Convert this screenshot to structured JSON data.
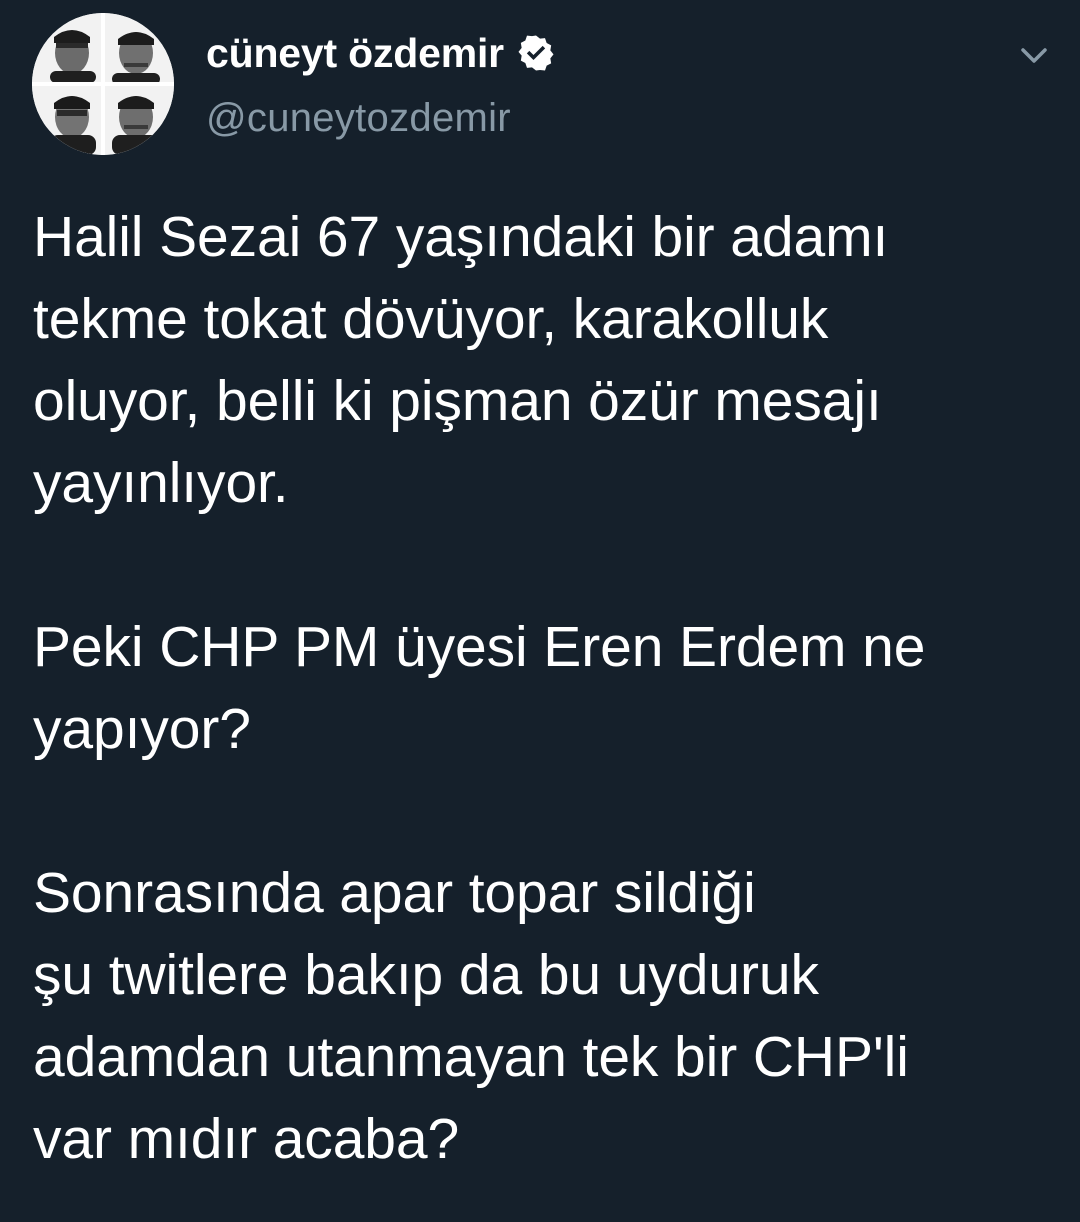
{
  "author": {
    "display_name": "cüneyt özdemir",
    "handle": "@cuneytozdemir",
    "verified": true,
    "avatar": "profile-photo-grid"
  },
  "menu": {
    "icon": "chevron-down-icon"
  },
  "tweet": {
    "paragraphs": [
      {
        "lines": [
          "Halil Sezai 67 yaşındaki bir adamı",
          "tekme tokat dövüyor, karakolluk",
          "oluyor, belli ki pişman özür mesajı",
          "yayınlıyor."
        ]
      },
      {
        "lines": [
          "Peki CHP PM üyesi Eren Erdem ne",
          "yapıyor?"
        ]
      },
      {
        "lines": [
          "Sonrasında apar topar sildiği",
          "şu twitlere bakıp da bu uyduruk",
          "adamdan utanmayan tek bir CHP'li",
          "var mıdır acaba?"
        ]
      }
    ]
  },
  "colors": {
    "background": "#15202b",
    "text": "#ffffff",
    "secondary_text": "#8899a6"
  }
}
